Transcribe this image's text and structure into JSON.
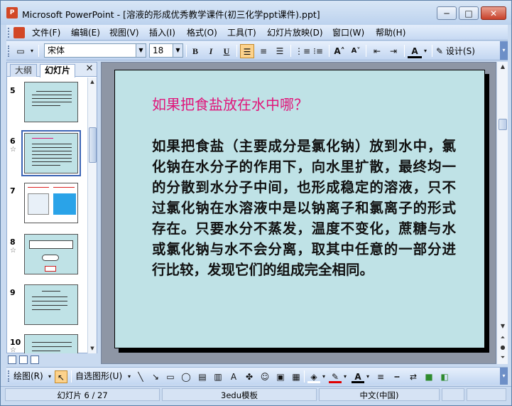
{
  "window": {
    "title": "Microsoft PowerPoint - [溶液的形成优秀教学课件(初三化学ppt课件).ppt]",
    "min_glyph": "─",
    "max_glyph": "□",
    "close_glyph": "✕"
  },
  "menu": {
    "items": [
      "文件(F)",
      "编辑(E)",
      "视图(V)",
      "插入(I)",
      "格式(O)",
      "工具(T)",
      "幻灯片放映(D)",
      "窗口(W)",
      "帮助(H)"
    ]
  },
  "format_toolbar": {
    "font_name": "宋体",
    "font_size": "18",
    "bold": "B",
    "italic": "I",
    "underline": "U",
    "design_label": "设计(S)"
  },
  "left_panel": {
    "tab_outline": "大纲",
    "tab_slides": "幻灯片",
    "close": "✕",
    "slides": [
      {
        "num": "5",
        "star": ""
      },
      {
        "num": "6",
        "star": "☆"
      },
      {
        "num": "7",
        "star": ""
      },
      {
        "num": "8",
        "star": "☆"
      },
      {
        "num": "9",
        "star": ""
      },
      {
        "num": "10",
        "star": "☆"
      }
    ]
  },
  "slide": {
    "title": "如果把食盐放在水中哪？",
    "body": "如果把食盐（主要成分是氯化钠）放到水中，氯化钠在水分子的作用下，向水里扩散，最终均一的分散到水分子中间，也形成稳定的溶液，只不过氯化钠在水溶液中是以钠离子和氯离子的形式存在。只要水分不蒸发，温度不变化，蔗糖与水或氯化钠与水不会分离，取其中任意的一部分进行比较，发现它们的组成完全相同。"
  },
  "draw_toolbar": {
    "draw_label": "绘图(R)",
    "autoshape_label": "自选图形(U)"
  },
  "status": {
    "slide_info": "幻灯片 6 / 27",
    "template": "3edu模板",
    "language": "中文(中国)"
  },
  "colors": {
    "slide_bg": "#bfe2e6",
    "title_color": "#e0157a",
    "chrome": "#c9daf0"
  }
}
